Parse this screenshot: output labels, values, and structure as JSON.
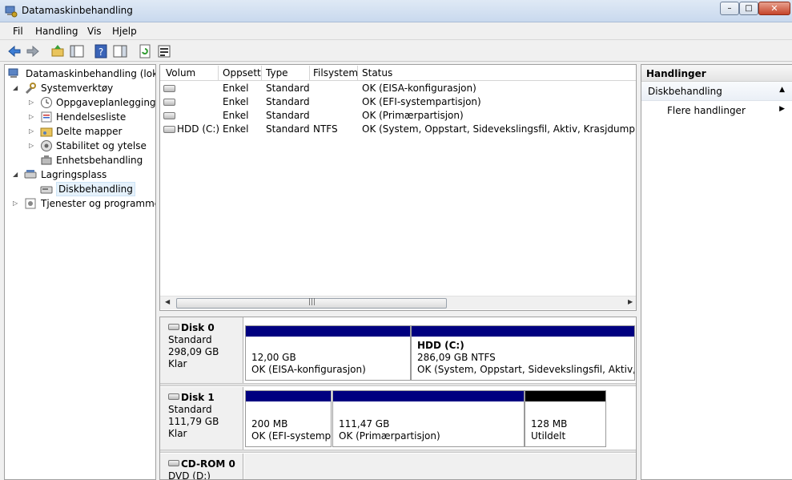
{
  "window": {
    "title": "Datamaskinbehandling",
    "controls": {
      "minimize": "–",
      "maximize": "□",
      "close": "✕"
    }
  },
  "menu": [
    "Fil",
    "Handling",
    "Vis",
    "Hjelp"
  ],
  "toolbar": {
    "buttons": [
      "back-icon",
      "forward-icon",
      "up-folder-icon",
      "show-hide-tree-icon",
      "help-icon",
      "show-hide-action-pane-icon",
      "refresh-icon",
      "properties-icon"
    ]
  },
  "tree": {
    "root": "Datamaskinbehandling (lokal)",
    "system_tools": "Systemverktøy",
    "task_scheduler": "Oppgaveplanlegging",
    "event_viewer": "Hendelsesliste",
    "shared_folders": "Delte mapper",
    "reliability": "Stabilitet og ytelse",
    "device_manager": "Enhetsbehandling",
    "storage": "Lagringsplass",
    "disk_management": "Diskbehandling",
    "services": "Tjenester og programmer"
  },
  "volumes": {
    "columns": [
      "Volum",
      "Oppsett",
      "Type",
      "Filsystem",
      "Status"
    ],
    "rows": [
      {
        "name": "",
        "layout": "Enkel",
        "type": "Standard",
        "fs": "",
        "status": "OK (EISA-konfigurasjon)"
      },
      {
        "name": "",
        "layout": "Enkel",
        "type": "Standard",
        "fs": "",
        "status": "OK (EFI-systempartisjon)"
      },
      {
        "name": "",
        "layout": "Enkel",
        "type": "Standard",
        "fs": "",
        "status": "OK (Primærpartisjon)"
      },
      {
        "name": "HDD (C:)",
        "layout": "Enkel",
        "type": "Standard",
        "fs": "NTFS",
        "status": "OK (System, Oppstart, Sidevekslingsfil, Aktiv, Krasjdump, Primærp"
      }
    ]
  },
  "disks": [
    {
      "name": "Disk 0",
      "type": "Standard",
      "size": "298,09 GB",
      "state": "Klar",
      "partitions": [
        {
          "name": "",
          "size": "12,00 GB",
          "status": "OK (EISA-konfigurasjon)"
        },
        {
          "name": "HDD  (C:)",
          "size": "286,09 GB NTFS",
          "status": "OK (System, Oppstart, Sidevekslingsfil, Aktiv, Krasj"
        }
      ]
    },
    {
      "name": "Disk 1",
      "type": "Standard",
      "size": "111,79 GB",
      "state": "Klar",
      "partitions": [
        {
          "name": "",
          "size": "200 MB",
          "status": "OK (EFI-systempa"
        },
        {
          "name": "",
          "size": "111,47 GB",
          "status": "OK (Primærpartisjon)"
        },
        {
          "name": "",
          "size": "128 MB",
          "status": "Utildelt"
        }
      ]
    },
    {
      "name": "CD-ROM 0",
      "type": "DVD (D:)"
    }
  ],
  "actions": {
    "header": "Handlinger",
    "section": "Diskbehandling",
    "more": "Flere handlinger"
  },
  "colors": {
    "primary_partition": "#000080",
    "unallocated": "#000000",
    "selection": "#e5f1fb"
  }
}
